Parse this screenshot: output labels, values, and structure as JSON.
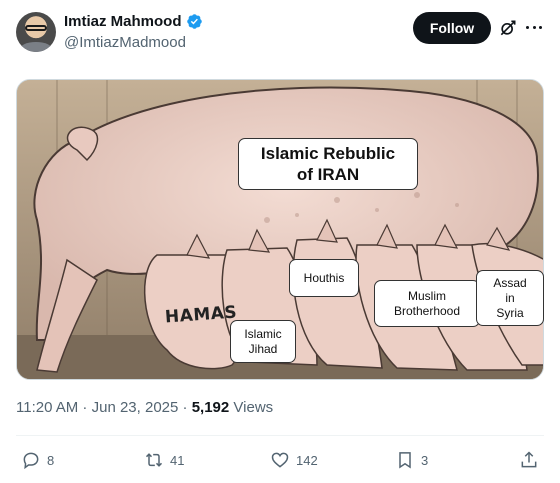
{
  "author": {
    "display_name": "Imtiaz Mahmood",
    "handle": "@ImtiazMadmood",
    "verified": true
  },
  "header": {
    "follow_label": "Follow",
    "grok_icon": "grok-icon",
    "more_icon": "more-icon"
  },
  "media": {
    "hamas_text": "HAMAS",
    "labels": {
      "iran": "Islamic Rebublic\nof IRAN",
      "houthis": "Houthis",
      "jihad": "Islamic\nJihad",
      "muslim": "Muslim\nBrotherhood",
      "assad": "Assad\nin\nSyria"
    }
  },
  "meta": {
    "time": "11:20 AM",
    "separator": " · ",
    "date": "Jun 23, 2025",
    "separator2": " · ",
    "views_count": "5,192",
    "views_label": " Views"
  },
  "actions": {
    "replies": "8",
    "reposts": "41",
    "likes": "142",
    "bookmarks": "3"
  },
  "colors": {
    "text_primary": "#0f1419",
    "text_secondary": "#536471",
    "verified_blue": "#1d9bf0",
    "divider": "#eff3f4"
  }
}
